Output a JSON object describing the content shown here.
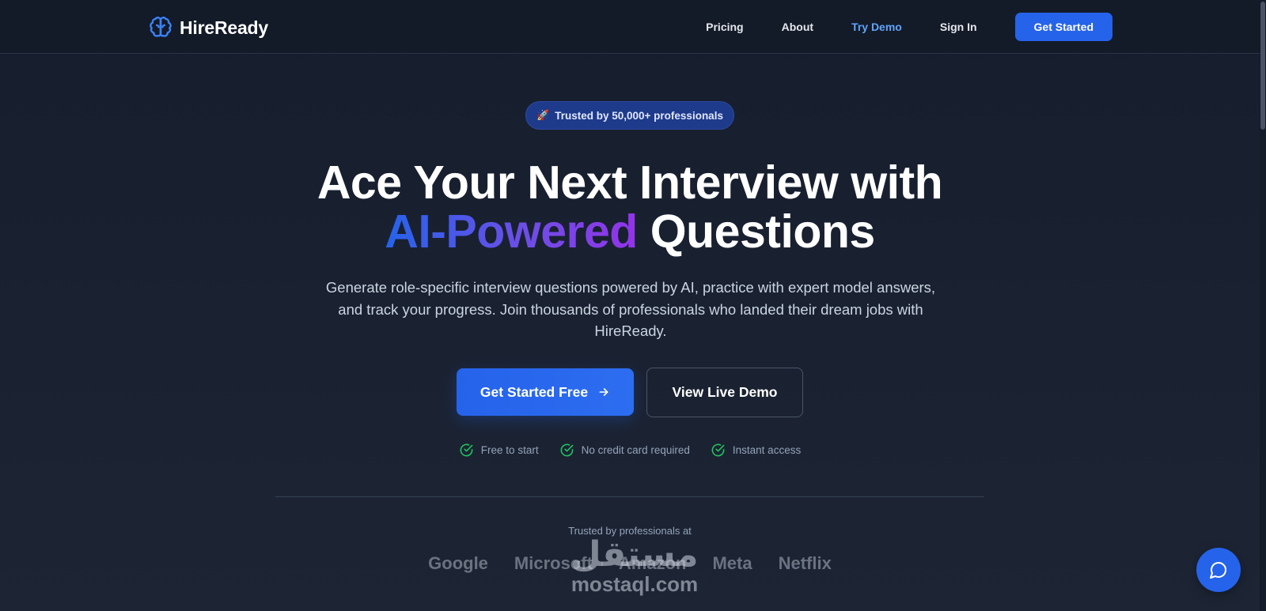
{
  "nav": {
    "brand": "HireReady",
    "links": [
      {
        "label": "Pricing",
        "active": false
      },
      {
        "label": "About",
        "active": false
      },
      {
        "label": "Try Demo",
        "active": true
      },
      {
        "label": "Sign In",
        "active": false
      }
    ],
    "cta_label": "Get Started"
  },
  "hero": {
    "badge_emoji": "🚀",
    "badge_text": "Trusted by 50,000+ professionals",
    "title_line1": "Ace Your Next Interview with",
    "title_highlight": "AI-Powered",
    "title_rest": "Questions",
    "subtitle": "Generate role-specific interview questions powered by AI, practice with expert model answers, and track your progress. Join thousands of professionals who landed their dream jobs with HireReady.",
    "primary_cta": "Get Started Free",
    "secondary_cta": "View Live Demo",
    "features": [
      "Free to start",
      "No credit card required",
      "Instant access"
    ]
  },
  "trusted": {
    "label": "Trusted by professionals at",
    "companies": [
      "Google",
      "Microsoft",
      "Amazon",
      "Meta",
      "Netflix"
    ]
  },
  "watermark": {
    "arabic": "مستقل",
    "latin": "mostaql.com"
  },
  "colors": {
    "accent": "#2563eb",
    "accent_light": "#60a5fa",
    "success": "#22c55e",
    "background": "#1a2232"
  },
  "icons": {
    "brand": "brain-icon",
    "cta_arrow": "arrow-right-icon",
    "feature": "check-circle-icon",
    "chat": "chat-bubble-icon"
  }
}
